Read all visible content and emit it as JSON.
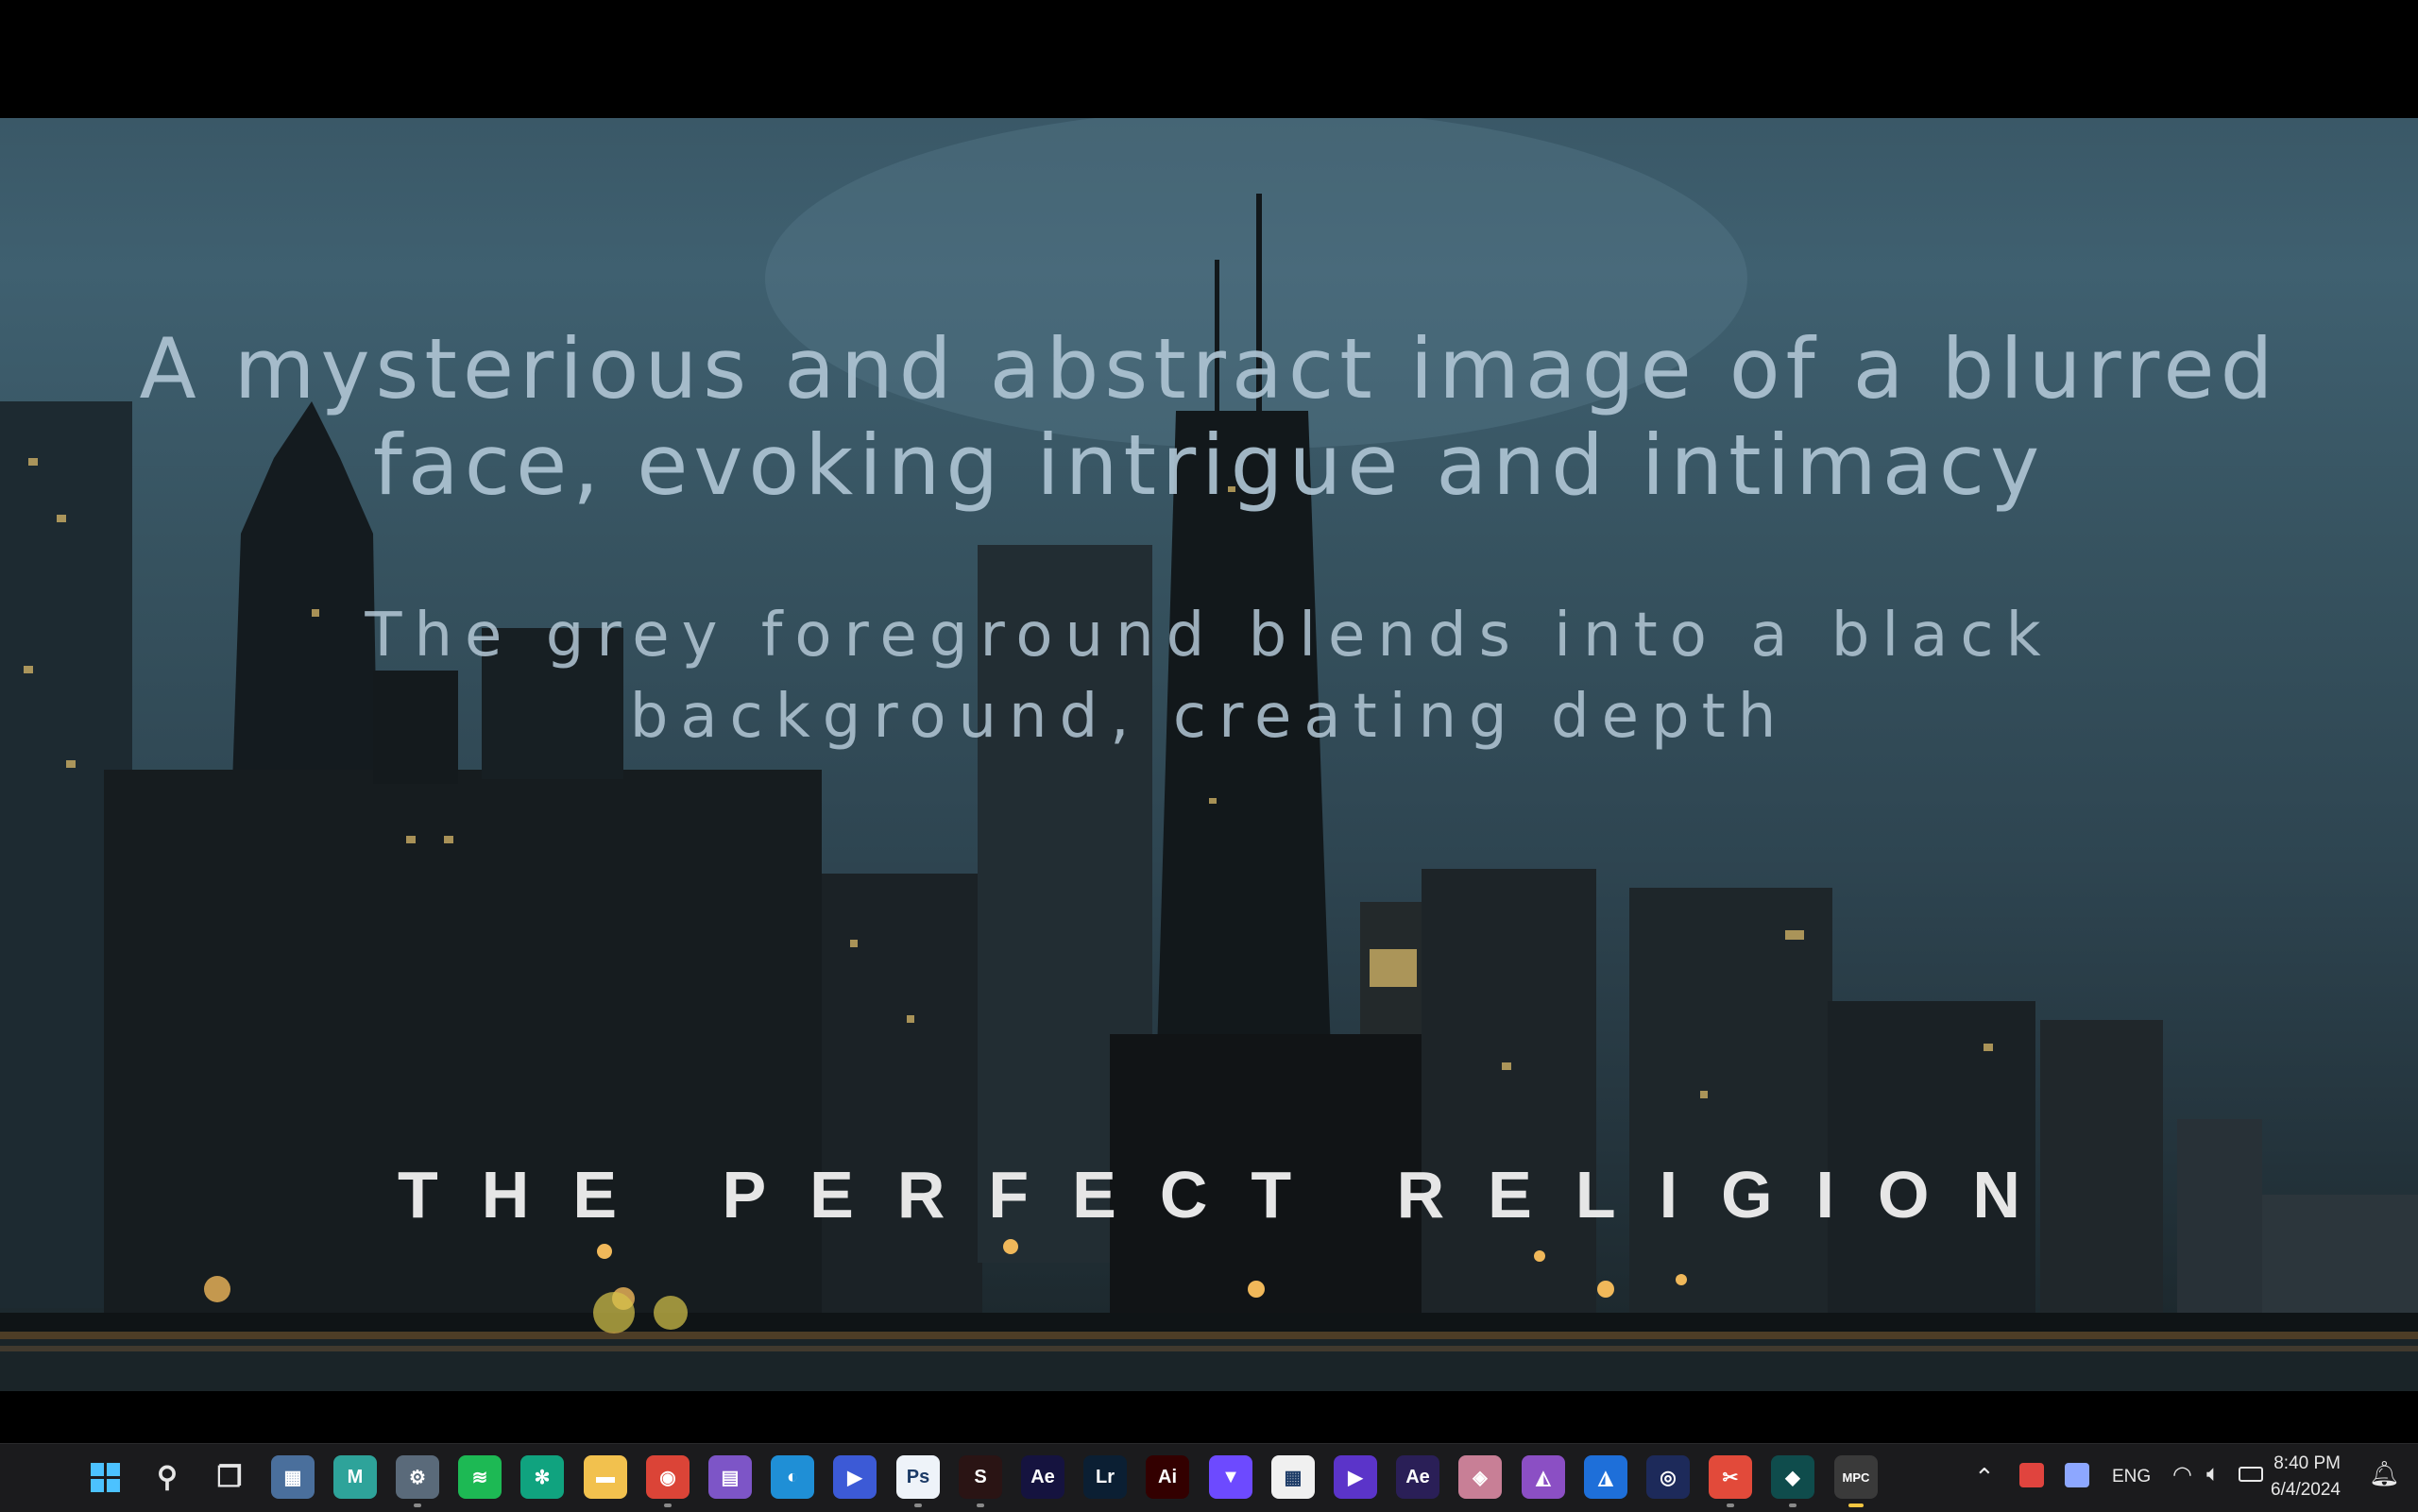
{
  "video": {
    "title": "A mysterious and abstract image of a blurred\nface, evoking intrigue and intimacy",
    "subtitle": "The grey foreground blends into a black\nbackground, creating depth",
    "credit": "THE PERFECT RELIGION"
  },
  "taskbar": {
    "apps": [
      {
        "name": "start-button",
        "icon": "windows-logo",
        "glyph": "",
        "color": "#1a7fe0"
      },
      {
        "name": "search-button",
        "icon": "search-icon",
        "glyph": "⚲",
        "color": "transparent"
      },
      {
        "name": "task-view-button",
        "icon": "task-view-icon",
        "glyph": "❐",
        "color": "transparent"
      },
      {
        "name": "calculator-app",
        "icon": "calculator-icon",
        "glyph": "▦",
        "color": "#4a6f9c"
      },
      {
        "name": "mindmap-app",
        "icon": "m-app-icon",
        "glyph": "M",
        "color": "#2ea39a"
      },
      {
        "name": "settings-app",
        "icon": "gear-icon",
        "glyph": "⚙",
        "color": "#5a6a7a"
      },
      {
        "name": "spotify-app",
        "icon": "spotify-icon",
        "glyph": "≋",
        "color": "#1db954"
      },
      {
        "name": "chatgpt-app",
        "icon": "openai-icon",
        "glyph": "✻",
        "color": "#10a37f"
      },
      {
        "name": "file-explorer-app",
        "icon": "folder-icon",
        "glyph": "▬",
        "color": "#f2c14e"
      },
      {
        "name": "chrome-app",
        "icon": "chrome-icon",
        "glyph": "◉",
        "color": "#db4437"
      },
      {
        "name": "clapper-app",
        "icon": "clapperboard-icon",
        "glyph": "▤",
        "color": "#7d55c7"
      },
      {
        "name": "edge-app",
        "icon": "edge-icon",
        "glyph": "◐",
        "color": "#1f8fd6"
      },
      {
        "name": "media-player-app",
        "icon": "play-icon",
        "glyph": "▶",
        "color": "#3c5ad6"
      },
      {
        "name": "photoshop-app",
        "icon": "ps-icon",
        "glyph": "Ps",
        "color": "#eef3f9"
      },
      {
        "name": "screen-recorder-app",
        "icon": "record-icon",
        "glyph": "S",
        "color": "#2a1414"
      },
      {
        "name": "after-effects-app",
        "icon": "ae-icon",
        "glyph": "Ae",
        "color": "#15133f"
      },
      {
        "name": "lightroom-app",
        "icon": "lr-icon",
        "glyph": "Lr",
        "color": "#0b1f33"
      },
      {
        "name": "illustrator-app",
        "icon": "ai-icon",
        "glyph": "Ai",
        "color": "#330000"
      },
      {
        "name": "proton-vpn-app",
        "icon": "shield-icon",
        "glyph": "▼",
        "color": "#6d4aff"
      },
      {
        "name": "microsoft-store-app",
        "icon": "store-icon",
        "glyph": "▦",
        "color": "#f0f0f0"
      },
      {
        "name": "video-editor-app",
        "icon": "editor-icon",
        "glyph": "▶",
        "color": "#5b34c9"
      },
      {
        "name": "ae-alt-app",
        "icon": "ae-icon",
        "glyph": "Ae",
        "color": "#2a1f57"
      },
      {
        "name": "box-app",
        "icon": "cube-icon",
        "glyph": "◈",
        "color": "#c87f96"
      },
      {
        "name": "affinity-photo-app",
        "icon": "affinity-photo-icon",
        "glyph": "◭",
        "color": "#8b4fc4"
      },
      {
        "name": "affinity-designer-app",
        "icon": "affinity-designer-icon",
        "glyph": "◮",
        "color": "#1e6fd9"
      },
      {
        "name": "cinema4d-app",
        "icon": "c4d-icon",
        "glyph": "◎",
        "color": "#1d2a5a"
      },
      {
        "name": "capcut-app",
        "icon": "capcut-icon",
        "glyph": "✂",
        "color": "#e24a3a"
      },
      {
        "name": "filmora-app",
        "icon": "filmora-icon",
        "glyph": "◆",
        "color": "#0f4c4c"
      },
      {
        "name": "mpc-be-app",
        "icon": "mpc-icon",
        "glyph": "MPC",
        "color": "#3a3a3a"
      }
    ],
    "tray": {
      "language": "ENG",
      "time": "8:40 PM",
      "date": "6/4/2024"
    }
  }
}
